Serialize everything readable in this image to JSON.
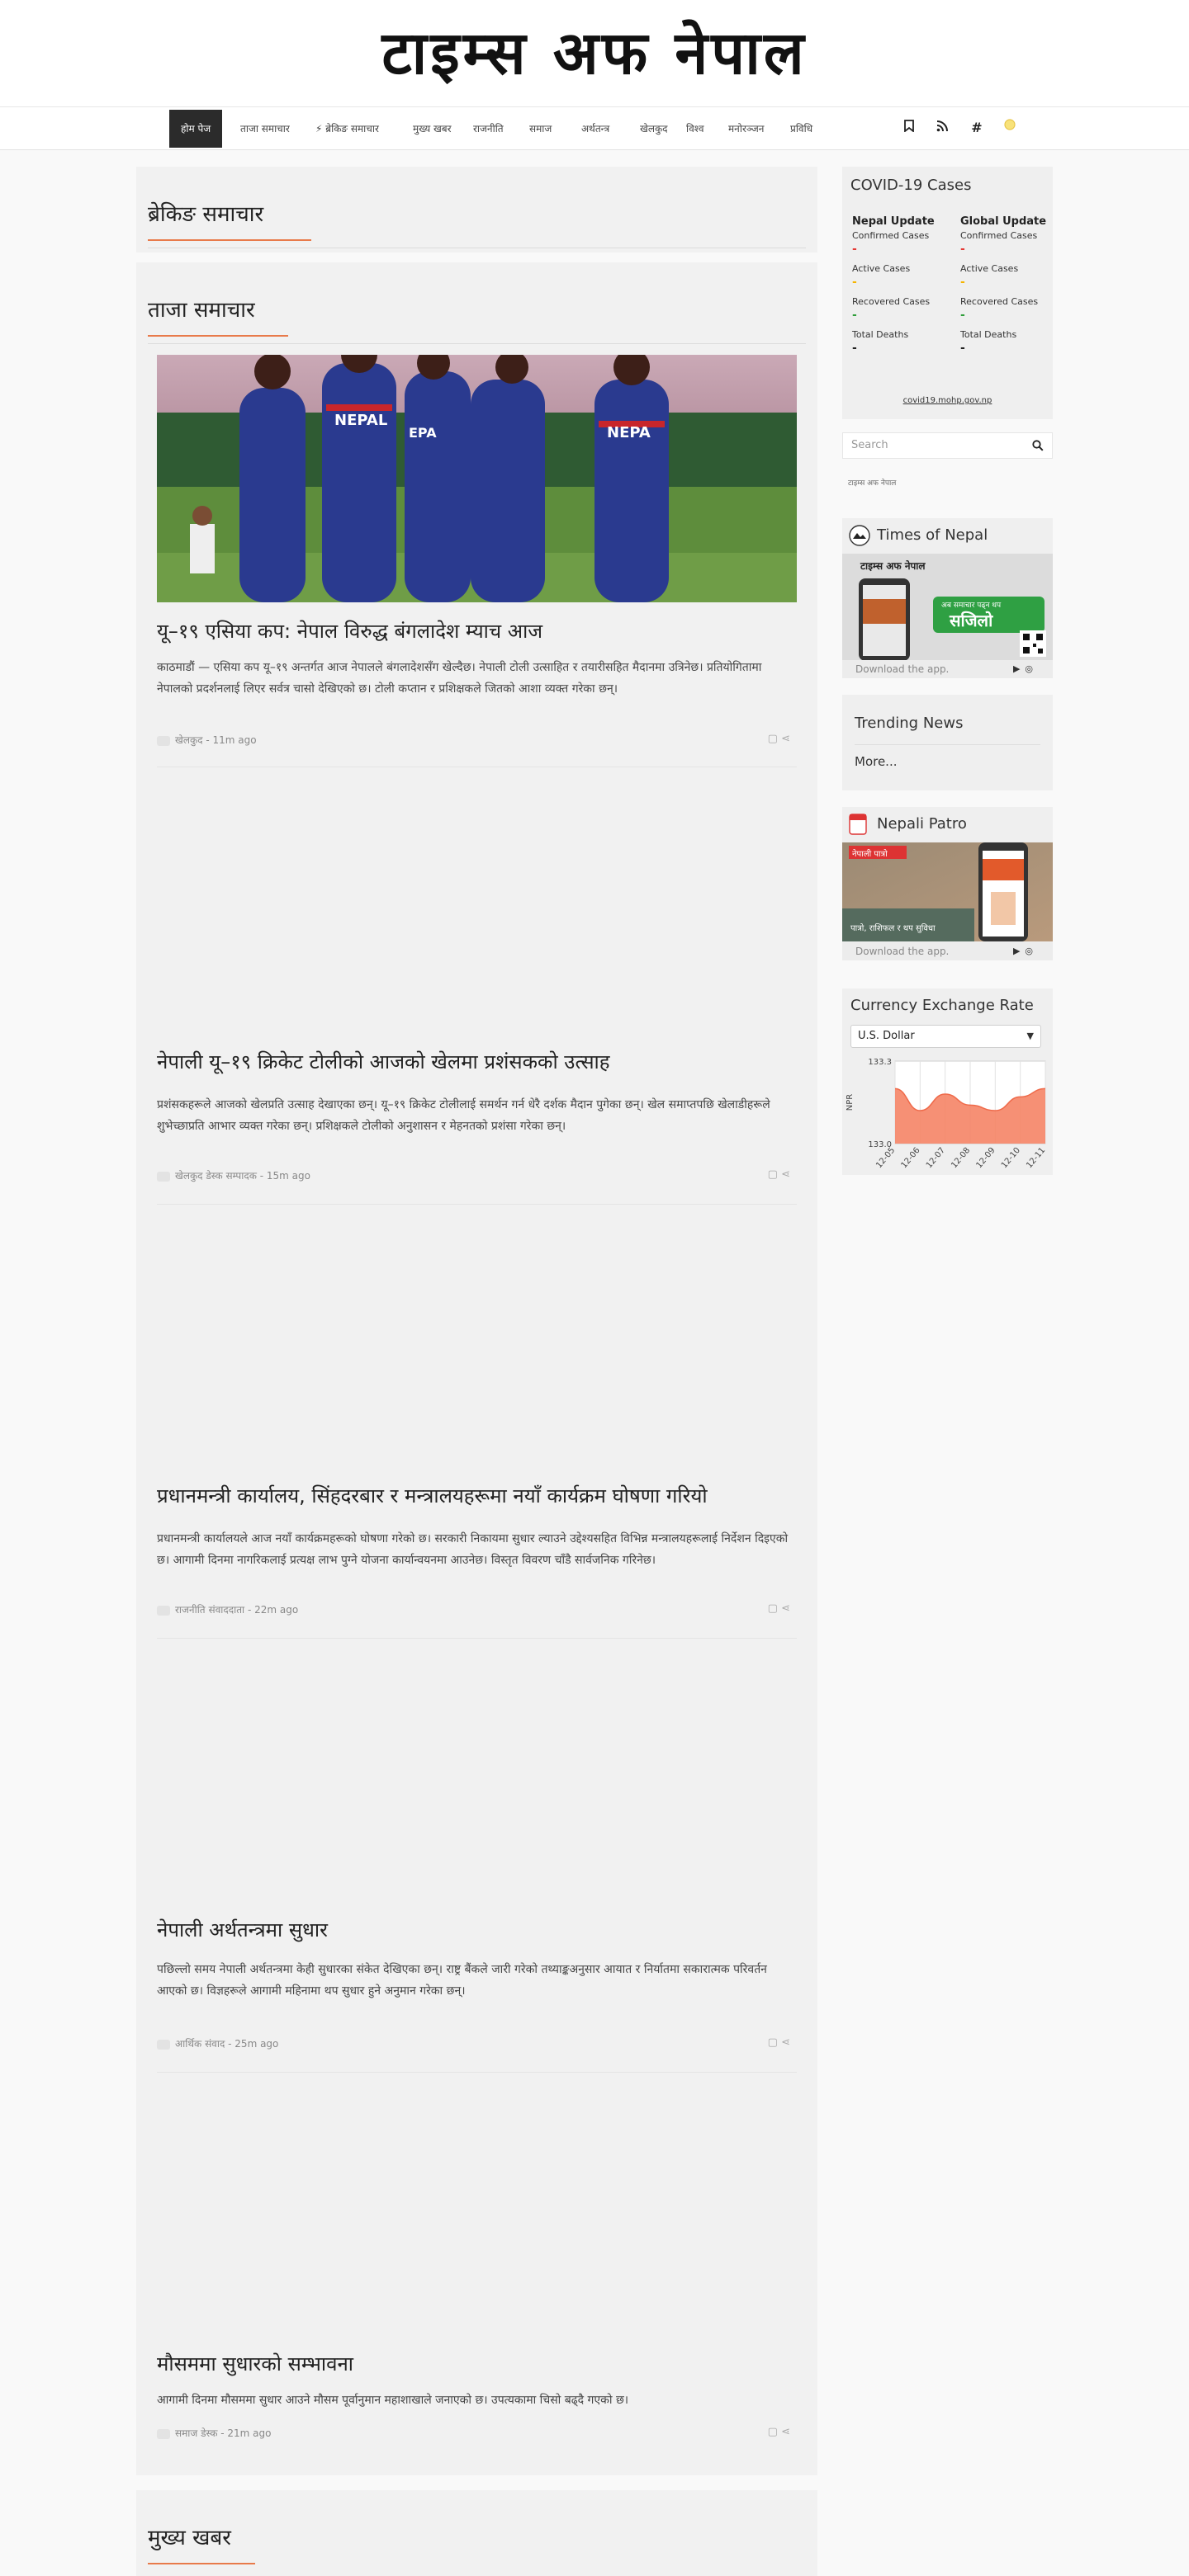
{
  "site": {
    "title": "टाइम्स अफ नेपाल"
  },
  "nav": {
    "items": [
      {
        "label": "होम पेज",
        "active": true
      },
      {
        "label": "ताजा समाचार",
        "active": false
      },
      {
        "label": "⚡ ब्रेकिङ समाचार",
        "active": false
      },
      {
        "label": "मुख्य खबर",
        "active": false
      },
      {
        "label": "राजनीति",
        "active": false
      },
      {
        "label": "समाज",
        "active": false
      },
      {
        "label": "अर्थतन्त्र",
        "active": false
      },
      {
        "label": "खेलकुद",
        "active": false
      },
      {
        "label": "विश्व",
        "active": false
      },
      {
        "label": "मनोरञ्जन",
        "active": false
      },
      {
        "label": "प्रविधि",
        "active": false
      }
    ],
    "icons": [
      "bookmark-icon",
      "rss-icon",
      "hashtag-icon",
      "theme-toggle-icon"
    ]
  },
  "main": {
    "section_one_title": "ब्रेकिङ समाचार",
    "section_two_title": "ताजा समाचार",
    "section_three_title": "मुख्य खबर",
    "articles": [
      {
        "title": "यू–१९ एसिया कप: नेपाल विरुद्ध बंगलादेश म्याच आज",
        "summary": "काठमाडौं — एसिया कप यू–१९ अन्तर्गत आज नेपालले बंगलादेशसँग खेल्दैछ। नेपाली टोली उत्साहित र तयारीसहित मैदानमा उत्रिनेछ। प्रतियोगितामा नेपालको प्रदर्शनलाई लिएर सर्वत्र चासो देखिएको छ। टोली कप्तान र प्रशिक्षकले जितको आशा व्यक्त गरेका छन्।",
        "meta": "खेलकुद - 11m ago",
        "image_alt": "Nepal cricket team players in blue jerseys celebrating on the field"
      },
      {
        "title": "नेपाली यू–१९ क्रिकेट टोलीको आजको खेलमा प्रशंसकको उत्साह",
        "summary": "प्रशंसकहरूले आजको खेलप्रति उत्साह देखाएका छन्। यू–१९ क्रिकेट टोलीलाई समर्थन गर्न धेरै दर्शक मैदान पुगेका छन्। खेल समाप्तपछि खेलाडीहरूले शुभेच्छाप्रति आभार व्यक्त गरेका छन्। प्रशिक्षकले टोलीको अनुशासन र मेहनतको प्रशंसा गरेका छन्।",
        "meta": "खेलकुद डेस्क सम्पादक - 15m ago"
      },
      {
        "title": "प्रधानमन्त्री कार्यालय, सिंहदरबार र मन्त्रालयहरूमा नयाँ कार्यक्रम घोषणा गरियो",
        "summary": "प्रधानमन्त्री कार्यालयले आज नयाँ कार्यक्रमहरूको घोषणा गरेको छ। सरकारी निकायमा सुधार ल्याउने उद्देश्यसहित विभिन्न मन्त्रालयहरूलाई निर्देशन दिइएको छ। आगामी दिनमा नागरिकलाई प्रत्यक्ष लाभ पुग्ने योजना कार्यान्वयनमा आउनेछ। विस्तृत विवरण चाँडै सार्वजनिक गरिनेछ।",
        "meta": "राजनीति संवाददाता - 22m ago"
      },
      {
        "title": "नेपाली अर्थतन्त्रमा सुधार",
        "summary": "पछिल्लो समय नेपाली अर्थतन्त्रमा केही सुधारका संकेत देखिएका छन्। राष्ट्र बैंकले जारी गरेको तथ्याङ्कअनुसार आयात र निर्यातमा सकारात्मक परिवर्तन आएको छ। विज्ञहरूले आगामी महिनामा थप सुधार हुने अनुमान गरेका छन्।",
        "meta": "आर्थिक संवाद - 25m ago"
      },
      {
        "title": "मौसममा सुधारको सम्भावना",
        "summary": "आगामी दिनमा मौसममा सुधार आउने मौसम पूर्वानुमान महाशाखाले जनाएको छ। उपत्यकामा चिसो बढ्दै गएको छ।",
        "meta": "समाज डेस्क - 21m ago"
      }
    ]
  },
  "sidebar": {
    "covid": {
      "title": "COVID-19 Cases",
      "nepal": {
        "heading": "Nepal Update",
        "confirmed_label": "Confirmed Cases",
        "confirmed": "-",
        "active_label": "Active Cases",
        "active": "-",
        "recovered_label": "Recovered Cases",
        "recovered": "-",
        "deaths_label": "Total Deaths",
        "deaths": "-"
      },
      "global": {
        "heading": "Global Update",
        "confirmed_label": "Confirmed Cases",
        "confirmed": "-",
        "active_label": "Active Cases",
        "active": "-",
        "recovered_label": "Recovered Cases",
        "recovered": "-",
        "deaths_label": "Total Deaths",
        "deaths": "-"
      },
      "source_link": "covid19.mohp.gov.np",
      "colors": {
        "confirmed": "#e53935",
        "active": "#f5b400",
        "recovered": "#2e9e3a",
        "deaths": "#222222"
      }
    },
    "search": {
      "placeholder": "Search",
      "caption": "टाइम्स अफ नेपाल"
    },
    "times_app": {
      "title": "Times of Nepal",
      "promo_brand": "टाइम्स अफ नेपाल",
      "promo_tagline": "अब समाचार पढ्न थप",
      "promo_badge": "सजिलो",
      "download": "Download the app."
    },
    "trending": {
      "title": "Trending News",
      "more": "More..."
    },
    "patro": {
      "title": "Nepali Patro",
      "promo_tag": "नेपाली पात्रो",
      "promo_caption": "पात्रो, राशिफल र थप सुविधा",
      "download": "Download the app."
    },
    "currency": {
      "title": "Currency Exchange Rate",
      "selected": "U.S. Dollar"
    }
  },
  "chart_data": {
    "type": "area",
    "title": "",
    "xlabel": "",
    "ylabel": "NPR",
    "x": [
      "12-05",
      "12-06",
      "12-07",
      "12-08",
      "12-09",
      "12-10",
      "12-11"
    ],
    "values": [
      133.2,
      133.12,
      133.18,
      133.14,
      133.12,
      133.17,
      133.2
    ],
    "ylim": [
      133.0,
      133.3
    ],
    "yticks": [
      "133.3",
      "133.0"
    ],
    "grid": true,
    "color": "#f58466"
  }
}
